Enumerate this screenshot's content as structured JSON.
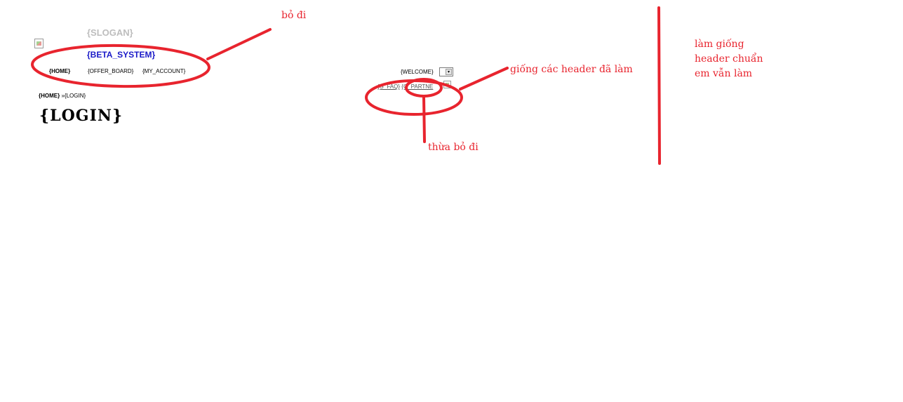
{
  "header": {
    "slogan": "{SLOGAN}",
    "site_title": "{BETA_SYSTEM}",
    "nav": {
      "home": "{HOME}",
      "offer_board": "{OFFER_BOARD}",
      "my_account": "{MY_ACCOUNT}"
    },
    "welcome": "{WELCOME}",
    "top_links": {
      "faq": "{G_FAQ}",
      "partner": "{G_PARTNE"
    }
  },
  "breadcrumb": {
    "home": "{HOME}",
    "separator": "»",
    "current": "{LOGIN}"
  },
  "page": {
    "title": "{LOGIN}"
  },
  "annotations": {
    "remove_top": "bỏ đi",
    "same_as_headers": "giống các header đã làm",
    "redundant_remove": "thừa bỏ đi",
    "right_note_line1": "làm giống",
    "right_note_line2": "header chuẩn",
    "right_note_line3": "em vẫn làm",
    "color": "#e8242e"
  }
}
